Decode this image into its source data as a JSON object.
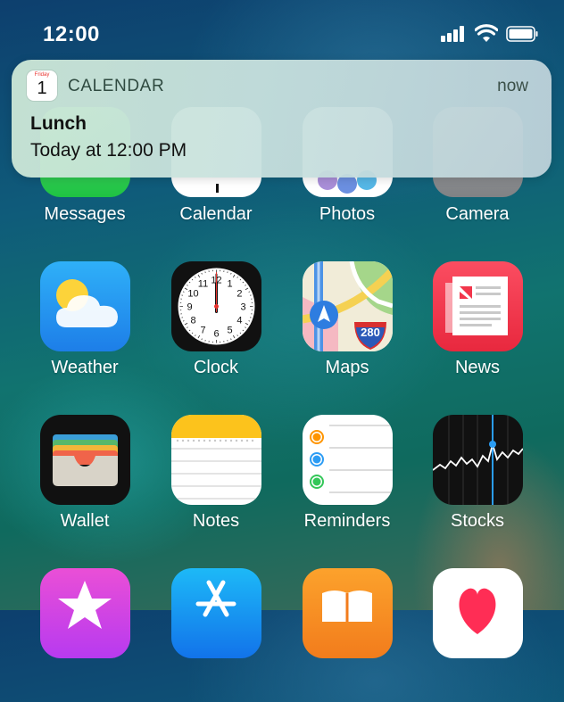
{
  "status_bar": {
    "time": "12:00"
  },
  "notification": {
    "icon_day": "Friday",
    "icon_date": "1",
    "app_name": "CALENDAR",
    "time": "now",
    "title": "Lunch",
    "body": "Today at 12:00 PM"
  },
  "apps": {
    "messages": "Messages",
    "calendar": "Calendar",
    "photos": "Photos",
    "camera": "Camera",
    "weather": "Weather",
    "clock": "Clock",
    "maps": "Maps",
    "maps_shield": "280",
    "news": "News",
    "wallet": "Wallet",
    "notes": "Notes",
    "reminders": "Reminders",
    "stocks": "Stocks"
  },
  "clock_numbers": [
    "12",
    "1",
    "2",
    "3",
    "4",
    "5",
    "6",
    "7",
    "8",
    "9",
    "10",
    "11"
  ],
  "colors": {
    "messages": "#34c759",
    "weather": "#1e9cf0",
    "news": "#f2364b",
    "notes_header": "#fcc31c",
    "reminder_orange": "#ff9500",
    "reminder_blue": "#2c9cf4",
    "reminder_green": "#34c759",
    "stocks_line": "#2a9df4"
  }
}
